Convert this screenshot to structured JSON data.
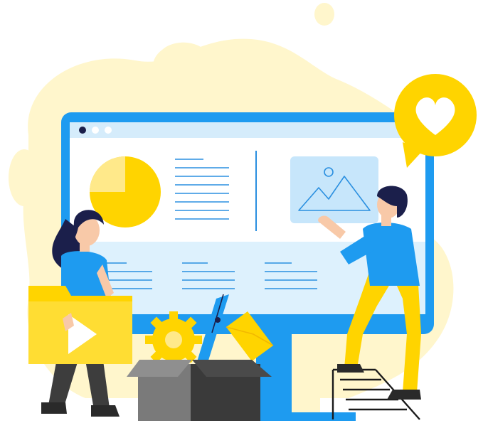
{
  "palette": {
    "blob": "#FFF6CC",
    "monitor_frame": "#1E9BF0",
    "screen": "#FFFFFF",
    "screen_panel": "#DDF1FD",
    "titlebar": "#D5ECFB",
    "line": "#2A8FE0",
    "yellow": "#FFD400",
    "yellow_light": "#FFE98A",
    "shirt_blue": "#1E9BF0",
    "skin": "#F8C9A8",
    "hair": "#1B1F4B",
    "dark_gray": "#3A3A3A",
    "mid_gray": "#6E6E6E",
    "pants_dark": "#3D3D3D"
  },
  "icons": {
    "window_dots": "window-controls-icon",
    "heart": "heart-icon",
    "pie": "pie-chart-icon",
    "image": "image-placeholder-icon",
    "play": "play-icon",
    "gear": "gear-icon",
    "pen": "pen-nib-icon",
    "envelope": "envelope-icon",
    "box": "box-icon",
    "ladder": "ladder-icon"
  }
}
